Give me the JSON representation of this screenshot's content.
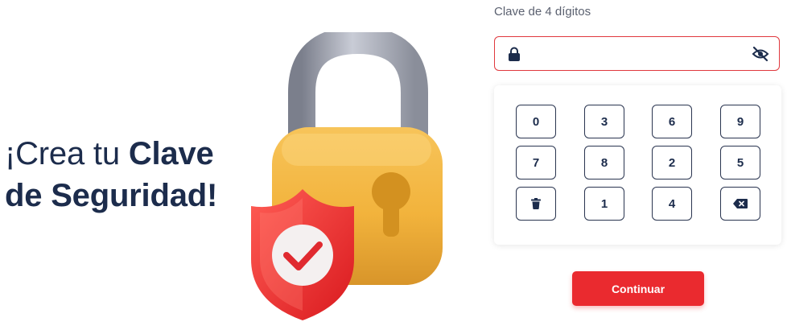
{
  "headline": {
    "part1": "¡Crea tu ",
    "part2": "Clave",
    "part3": "de Seguridad!"
  },
  "pin_field": {
    "label": "Clave de 4 dígitos",
    "value": "",
    "placeholder": "",
    "leading_icon": "lock-icon",
    "trailing_icon": "eye-off-icon"
  },
  "keypad": {
    "rows": [
      [
        "0",
        "3",
        "6",
        "9"
      ],
      [
        "7",
        "8",
        "2",
        "5"
      ],
      [
        "trash-icon",
        "1",
        "4",
        "backspace-icon"
      ]
    ]
  },
  "continue_button": {
    "label": "Continuar"
  },
  "colors": {
    "primary_red": "#ea2a2f",
    "text_dark": "#1c2c4c",
    "border_dark": "#2a3550",
    "error_border": "#e0393e"
  }
}
